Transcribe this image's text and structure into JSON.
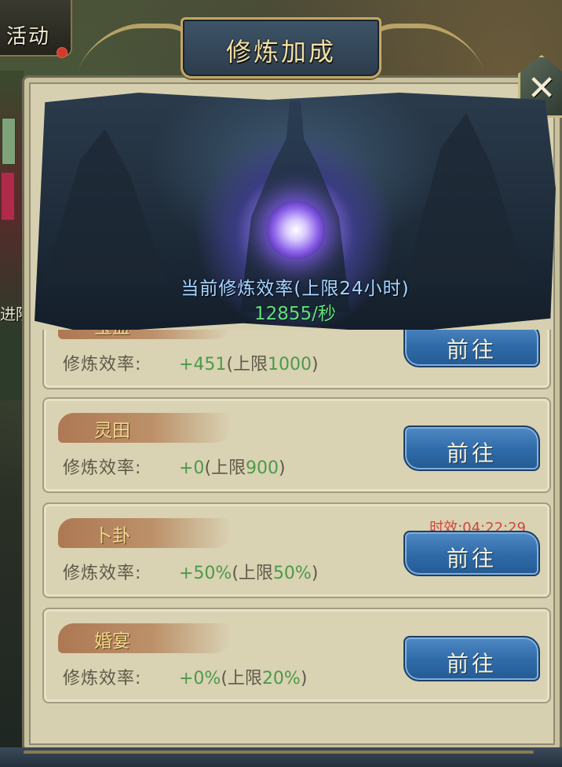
{
  "sidebar": {
    "activity_label": "活动",
    "side_text": "进阶"
  },
  "panel": {
    "title": "修炼加成",
    "close_label": "✕",
    "hero": {
      "caption": "当前修炼效率(上限24小时)",
      "rate": "12855/秒"
    },
    "items": [
      {
        "name": "宝盒",
        "label": "修炼效率:",
        "value": "+451",
        "limit_prefix": "(上限",
        "limit": "1000",
        "limit_suffix": ")",
        "timer": "",
        "button": "前往"
      },
      {
        "name": "灵田",
        "label": "修炼效率:",
        "value": "+0",
        "limit_prefix": "(上限",
        "limit": "900",
        "limit_suffix": ")",
        "timer": "",
        "button": "前往"
      },
      {
        "name": "卜卦",
        "label": "修炼效率:",
        "value": "+50%",
        "limit_prefix": "(上限",
        "limit": "50%",
        "limit_suffix": ")",
        "timer": "时效:04:22:29",
        "button": "前往"
      },
      {
        "name": "婚宴",
        "label": "修炼效率:",
        "value": "+0%",
        "limit_prefix": "(上限",
        "limit": "20%",
        "limit_suffix": ")",
        "timer": "",
        "button": "前往"
      }
    ]
  },
  "colors": {
    "accent_gold": "#c3a866",
    "button_blue": "#2f6aa8",
    "value_green": "#4c9a4a",
    "timer_red": "#d0483a"
  },
  "icons": {
    "close": "close-icon",
    "orb": "cultivation-orb"
  }
}
